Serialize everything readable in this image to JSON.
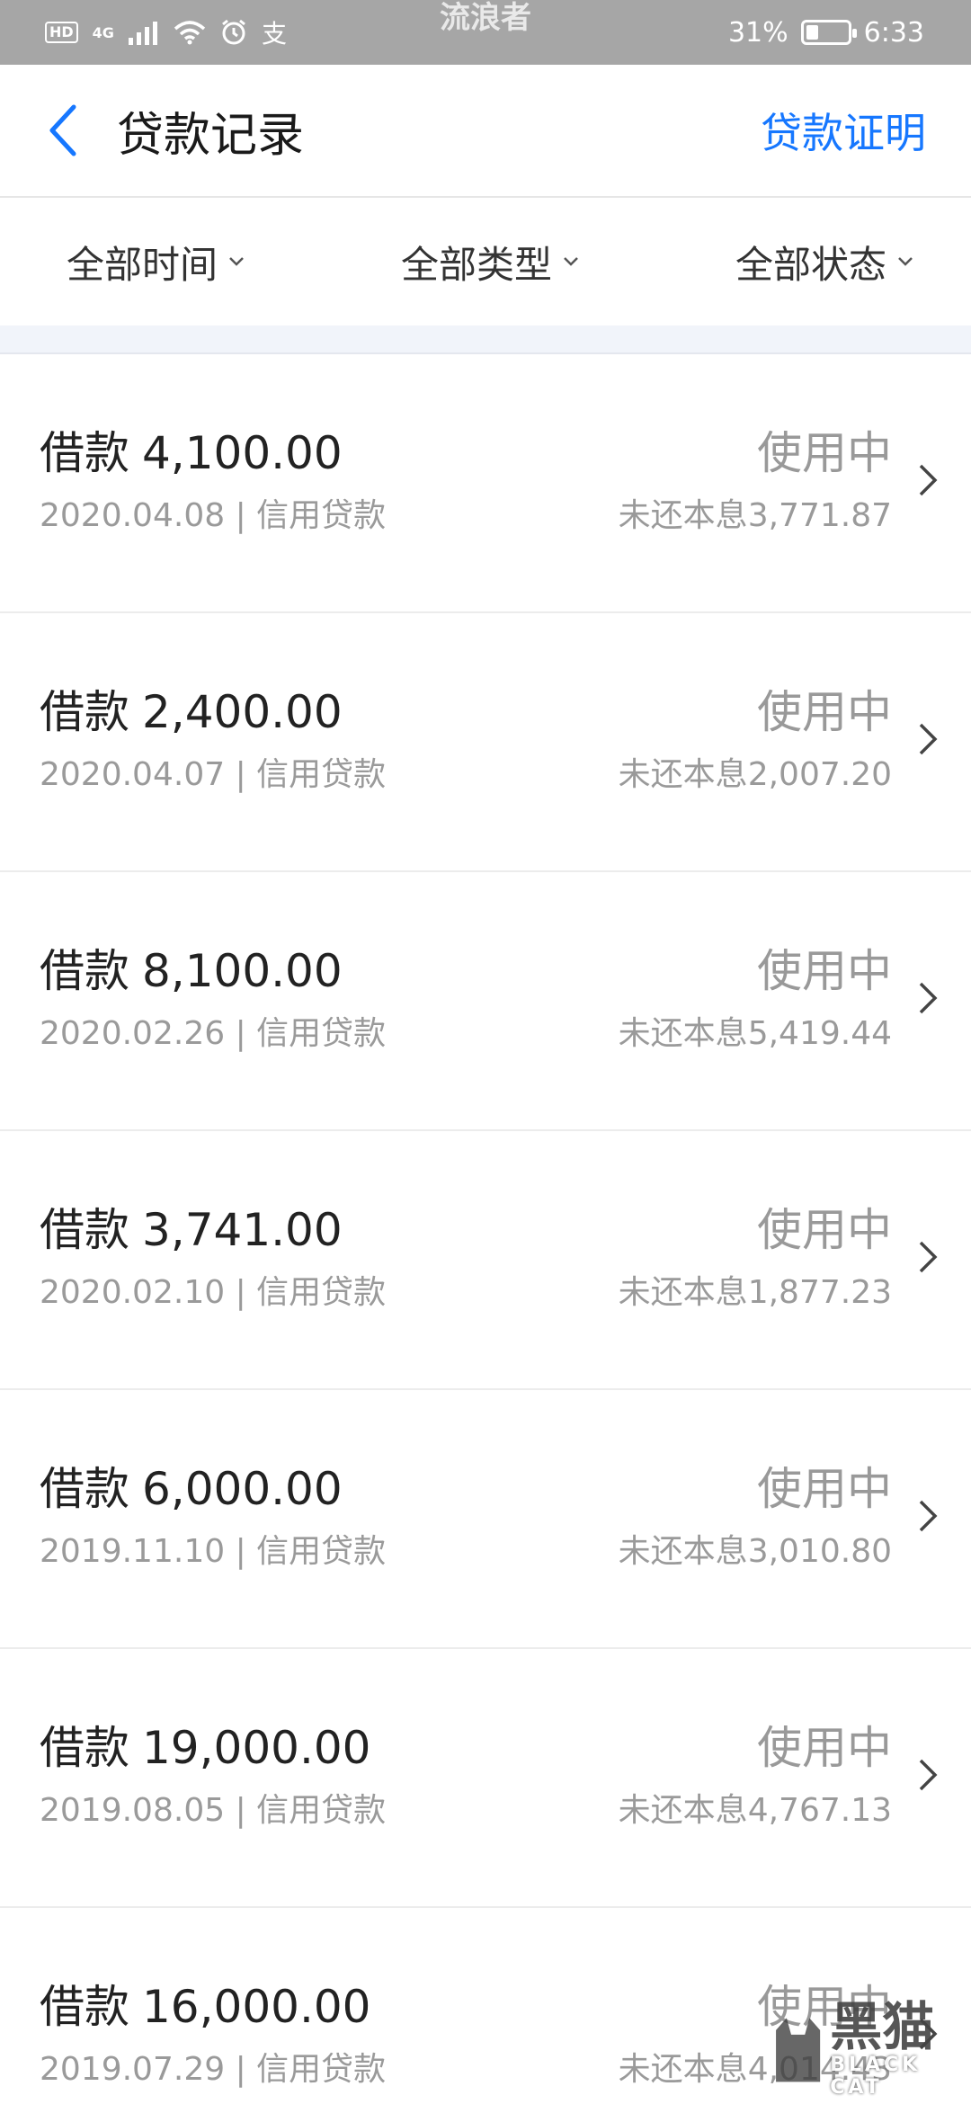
{
  "status_bar": {
    "badge": "HD",
    "network": "4G",
    "app_glyph": "支",
    "center_text": "流浪者",
    "battery": "31%",
    "battery_level": 0.31,
    "time": "6:33"
  },
  "nav": {
    "title": "贷款记录",
    "action": "贷款证明"
  },
  "filters": [
    {
      "label": "全部时间"
    },
    {
      "label": "全部类型"
    },
    {
      "label": "全部状态"
    }
  ],
  "loans": [
    {
      "prefix": "借款",
      "amount": "4,100.00",
      "date": "2020.04.08",
      "sep": "|",
      "type": "信用贷款",
      "status": "使用中",
      "remain_label": "未还本息",
      "remain": "3,771.87"
    },
    {
      "prefix": "借款",
      "amount": "2,400.00",
      "date": "2020.04.07",
      "sep": "|",
      "type": "信用贷款",
      "status": "使用中",
      "remain_label": "未还本息",
      "remain": "2,007.20"
    },
    {
      "prefix": "借款",
      "amount": "8,100.00",
      "date": "2020.02.26",
      "sep": "|",
      "type": "信用贷款",
      "status": "使用中",
      "remain_label": "未还本息",
      "remain": "5,419.44"
    },
    {
      "prefix": "借款",
      "amount": "3,741.00",
      "date": "2020.02.10",
      "sep": "|",
      "type": "信用贷款",
      "status": "使用中",
      "remain_label": "未还本息",
      "remain": "1,877.23"
    },
    {
      "prefix": "借款",
      "amount": "6,000.00",
      "date": "2019.11.10",
      "sep": "|",
      "type": "信用贷款",
      "status": "使用中",
      "remain_label": "未还本息",
      "remain": "3,010.80"
    },
    {
      "prefix": "借款",
      "amount": "19,000.00",
      "date": "2019.08.05",
      "sep": "|",
      "type": "信用贷款",
      "status": "使用中",
      "remain_label": "未还本息",
      "remain": "4,767.13"
    },
    {
      "prefix": "借款",
      "amount": "16,000.00",
      "date": "2019.07.29",
      "sep": "|",
      "type": "信用贷款",
      "status": "使用中",
      "remain_label": "未还本息",
      "remain": "4,014.43"
    }
  ],
  "watermark": {
    "text": "黑猫",
    "sub": "BLACK CAT"
  },
  "colors": {
    "accent": "#1677ff",
    "status_bar": "#a6a6a6",
    "muted_text": "#9a9a9a"
  }
}
